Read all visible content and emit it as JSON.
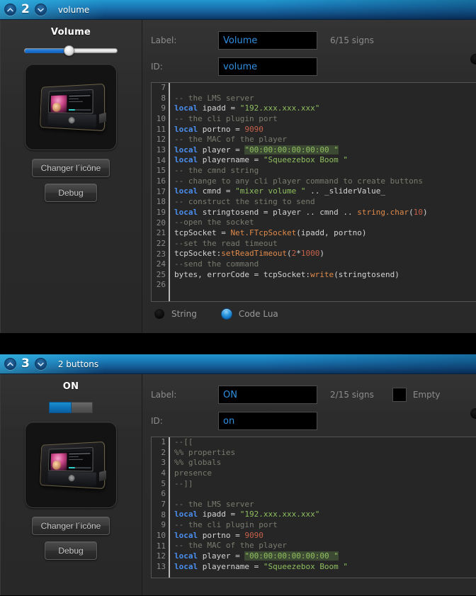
{
  "panels": [
    {
      "header": {
        "number": "2",
        "title": "volume",
        "up_icon": "chevron-up-icon",
        "down_icon": "chevron-down-icon"
      },
      "widget": {
        "title": "Volume",
        "type": "slider",
        "slider_fill_percent": 47
      },
      "icon_buttons": {
        "change_icon": "Changer l´icône",
        "debug": "Debug"
      },
      "fields": {
        "label_caption": "Label:",
        "label_value": "Volume",
        "signs": "6/15 signs",
        "id_caption": "ID:",
        "id_value": "volume",
        "empty_caption": null
      },
      "editor": {
        "first_line_number": 7,
        "lines": [
          "",
          "-- the LMS server",
          "local ipadd = \"192.xxx.xxx.xxx\"",
          "-- the cli plugin port",
          "local portno = 9090",
          "-- the MAC of the player",
          "local player = \"00:00:00:00:00:00 \"",
          "local playername = \"Squeezebox Boom \"",
          "-- the cmnd string",
          "-- change to any cli player command to create buttons",
          "local cmnd = \"mixer volume \" .. _sliderValue_",
          "-- construct the sting to send",
          "local stringtosend = player .. cmnd .. string.char(10)",
          "--open the socket",
          "tcpSocket = Net.FTcpSocket(ipadd, portno)",
          "--set the read timeout",
          "tcpSocket:setReadTimeout(2*1000)",
          "--send the command",
          "bytes, errorCode = tcpSocket:write(stringtosend)",
          ""
        ]
      },
      "radios": [
        {
          "label": "String",
          "selected": false
        },
        {
          "label": "Code Lua",
          "selected": true
        }
      ]
    },
    {
      "header": {
        "number": "3",
        "title": "2 buttons",
        "up_icon": "chevron-up-icon",
        "down_icon": "chevron-down-icon"
      },
      "widget": {
        "title": "ON",
        "type": "toggle",
        "on_label": "",
        "off_label": ""
      },
      "icon_buttons": {
        "change_icon": "Changer l´icône",
        "debug": "Debug"
      },
      "fields": {
        "label_caption": "Label:",
        "label_value": "ON",
        "signs": "2/15 signs",
        "id_caption": "ID:",
        "id_value": "on",
        "empty_caption": "Empty"
      },
      "editor": {
        "first_line_number": 1,
        "lines": [
          "--[[",
          "%% properties",
          "%% globals",
          "presence",
          "--]]",
          "",
          "-- the LMS server",
          "local ipadd = \"192.xxx.xxx.xxx\"",
          "-- the cli plugin port",
          "local portno = 9090",
          "-- the MAC of the player",
          "local player = \"00:00:00:00:00:00 \"",
          "local playername = \"Squeezebox Boom \""
        ]
      },
      "radios": []
    }
  ],
  "colors": {
    "header_blue_light": "#2aa3d4",
    "header_blue_dark": "#0b3663",
    "panel_bg": "#2d2d2d",
    "input_text_blue": "#2f8fe0",
    "accent_blue": "#1a7fb8",
    "editor_bg": "#262626",
    "comment_gray": "#7a7a6f",
    "string_green": "#8fbf5f",
    "keyword_blue": "#4a8ff0",
    "number_red": "#c4604a"
  }
}
